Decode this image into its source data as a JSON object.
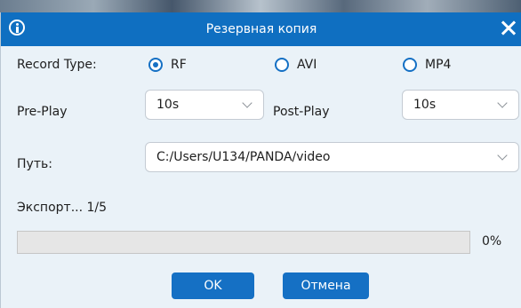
{
  "dialog": {
    "title": "Резервная копия"
  },
  "icons": {
    "info": "info-icon",
    "close": "close-icon",
    "dropdown": "chevron-down-icon"
  },
  "colors": {
    "title_bar": "#0f6fc1",
    "accent": "#1570c4",
    "dialog_bg": "#eaf2f8"
  },
  "record_type": {
    "label": "Record Type:",
    "options": [
      {
        "label": "RF",
        "checked": true
      },
      {
        "label": "AVI",
        "checked": false
      },
      {
        "label": "MP4",
        "checked": false
      }
    ]
  },
  "pre_play": {
    "label": "Pre-Play",
    "value": "10s"
  },
  "post_play": {
    "label": "Post-Play",
    "value": "10s"
  },
  "path": {
    "label": "Путь:",
    "value": "C:/Users/U134/PANDA/video"
  },
  "export": {
    "status": "Экспорт... 1/5",
    "progress": 0,
    "percent_label": "0%"
  },
  "buttons": {
    "ok": "OK",
    "cancel": "Отмена"
  }
}
